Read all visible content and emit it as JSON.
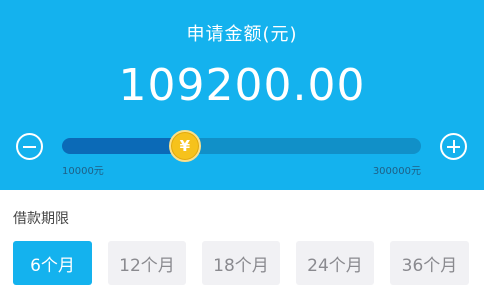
{
  "header": {
    "title": "申请金额(元)",
    "amount": "109200.00",
    "bg_color": "#14b2ee"
  },
  "slider": {
    "min_label": "10000元",
    "max_label": "300000元",
    "min_value": 10000,
    "max_value": 300000,
    "value": 109200,
    "thumb_symbol": "¥",
    "minus_icon": "minus-circle-icon",
    "plus_icon": "plus-circle-icon"
  },
  "term": {
    "title": "借款期限",
    "options": [
      "6个月",
      "12个月",
      "18个月",
      "24个月",
      "36个月"
    ],
    "selected": "6个月",
    "accent_color": "#14b2ee"
  }
}
